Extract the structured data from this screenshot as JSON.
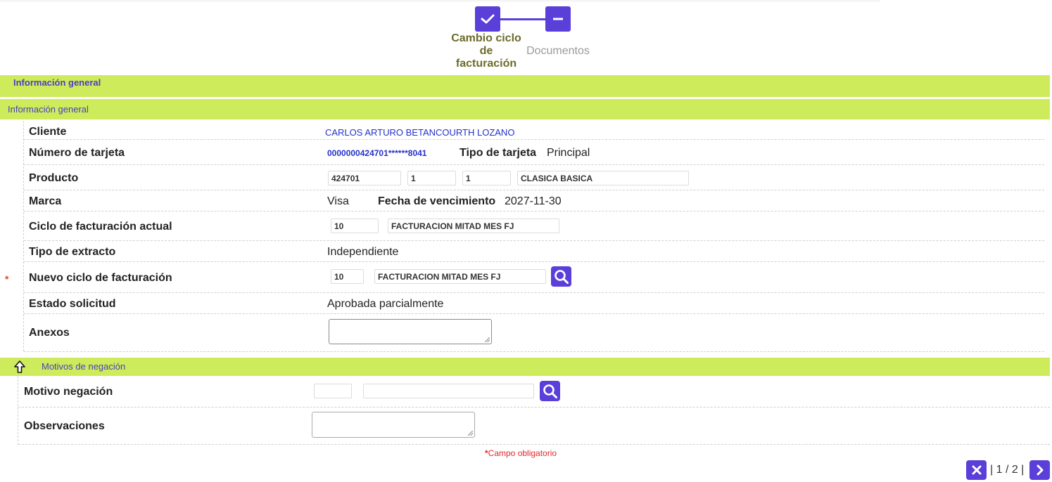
{
  "stepper": {
    "steps": [
      {
        "label": "Cambio ciclo de facturación",
        "state": "completed"
      },
      {
        "label": "Documentos",
        "state": "current"
      }
    ]
  },
  "sections": {
    "general_outer": "Información general",
    "general_inner": "Información general",
    "denial": "Motivos de negación"
  },
  "form": {
    "cliente": {
      "label": "Cliente",
      "value": "CARLOS ARTURO BETANCOURTH LOZANO"
    },
    "tarjeta": {
      "label": "Número de tarjeta",
      "value": "0000000424701******8041",
      "tipo_label": "Tipo de tarjeta",
      "tipo_value": "Principal"
    },
    "producto": {
      "label": "Producto",
      "code": "424701",
      "f2": "1",
      "f3": "1",
      "name": "CLASICA BASICA"
    },
    "marca": {
      "label": "Marca",
      "value": "Visa",
      "venc_label": "Fecha de vencimiento",
      "venc_value": "2027-11-30"
    },
    "ciclo_actual": {
      "label": "Ciclo de facturación actual",
      "code": "10",
      "name": "FACTURACION MITAD MES FJ"
    },
    "tipo_extracto": {
      "label": "Tipo de extracto",
      "value": "Independiente"
    },
    "nuevo_ciclo": {
      "label": "Nuevo ciclo de facturación",
      "code": "10",
      "name": "FACTURACION MITAD MES FJ",
      "required_mark": "*"
    },
    "estado": {
      "label": "Estado solicitud",
      "value": "Aprobada parcialmente"
    },
    "anexos": {
      "label": "Anexos",
      "value": ""
    }
  },
  "denial": {
    "motivo": {
      "label": "Motivo negación",
      "code": "",
      "name": ""
    },
    "observaciones": {
      "label": "Observaciones",
      "value": ""
    }
  },
  "footer": {
    "required_note": "Campo obligatorio",
    "required_mark": "*",
    "pagination": "| 1 / 2 |"
  },
  "icons": {
    "step_done": "check-icon",
    "step_current": "minus-icon",
    "search": "search-icon",
    "collapse": "arrow-up-icon",
    "close": "close-icon",
    "next": "chevron-right-icon"
  },
  "colors": {
    "accent": "#5b3fd9",
    "section_bar": "#cdeb5a",
    "section_text": "#4b3fc4",
    "value_blue": "#2431c9",
    "required": "#e4472a"
  }
}
